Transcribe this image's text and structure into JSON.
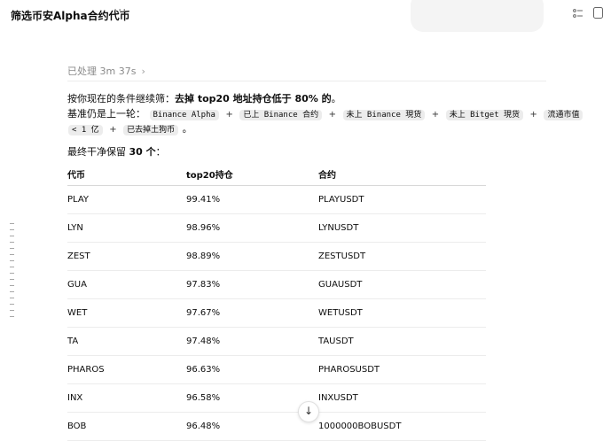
{
  "header": {
    "title": "筛选币安Alpha合约代币",
    "more_label": "···"
  },
  "message": {
    "processed_label": "已处理 3m 37s",
    "chevron": "›",
    "p1_prefix": "按你现在的条件继续筛：",
    "p1_bold": "去掉 top20 地址持仓低于 80% 的",
    "p1_suffix": "。",
    "baseline_prefix": "基准仍是上一轮：",
    "criteria": [
      "Binance Alpha",
      "已上 Binance 合约",
      "未上 Binance 現货",
      "未上 Bitget 現货",
      "流通市值",
      "< 1 亿",
      "已去掉土狗币"
    ],
    "plus": "+",
    "line3_end": "。",
    "result_prefix": "最终干净保留 ",
    "result_count": "30 个",
    "result_suffix": "："
  },
  "table": {
    "headers": [
      "代币",
      "top20持仓",
      "合约"
    ],
    "rows": [
      [
        "PLAY",
        "99.41%",
        "PLAYUSDT"
      ],
      [
        "LYN",
        "98.96%",
        "LYNUSDT"
      ],
      [
        "ZEST",
        "98.89%",
        "ZESTUSDT"
      ],
      [
        "GUA",
        "97.83%",
        "GUAUSDT"
      ],
      [
        "WET",
        "97.67%",
        "WETUSDT"
      ],
      [
        "TA",
        "97.48%",
        "TAUSDT"
      ],
      [
        "PHAROS",
        "96.63%",
        "PHAROSUSDT"
      ],
      [
        "INX",
        "96.58%",
        "INXUSDT"
      ],
      [
        "BOB",
        "96.48%",
        "1000000BOBUSDT"
      ]
    ]
  },
  "icons": {
    "top_right": [
      "list-settings-icon",
      "panel-icon"
    ],
    "scroll_down": "arrow-down-icon",
    "scroll_glyph": "↓"
  },
  "colors": {
    "background": "#ffffff",
    "muted_text": "#8a8a8a",
    "code_bg": "#ececec"
  }
}
